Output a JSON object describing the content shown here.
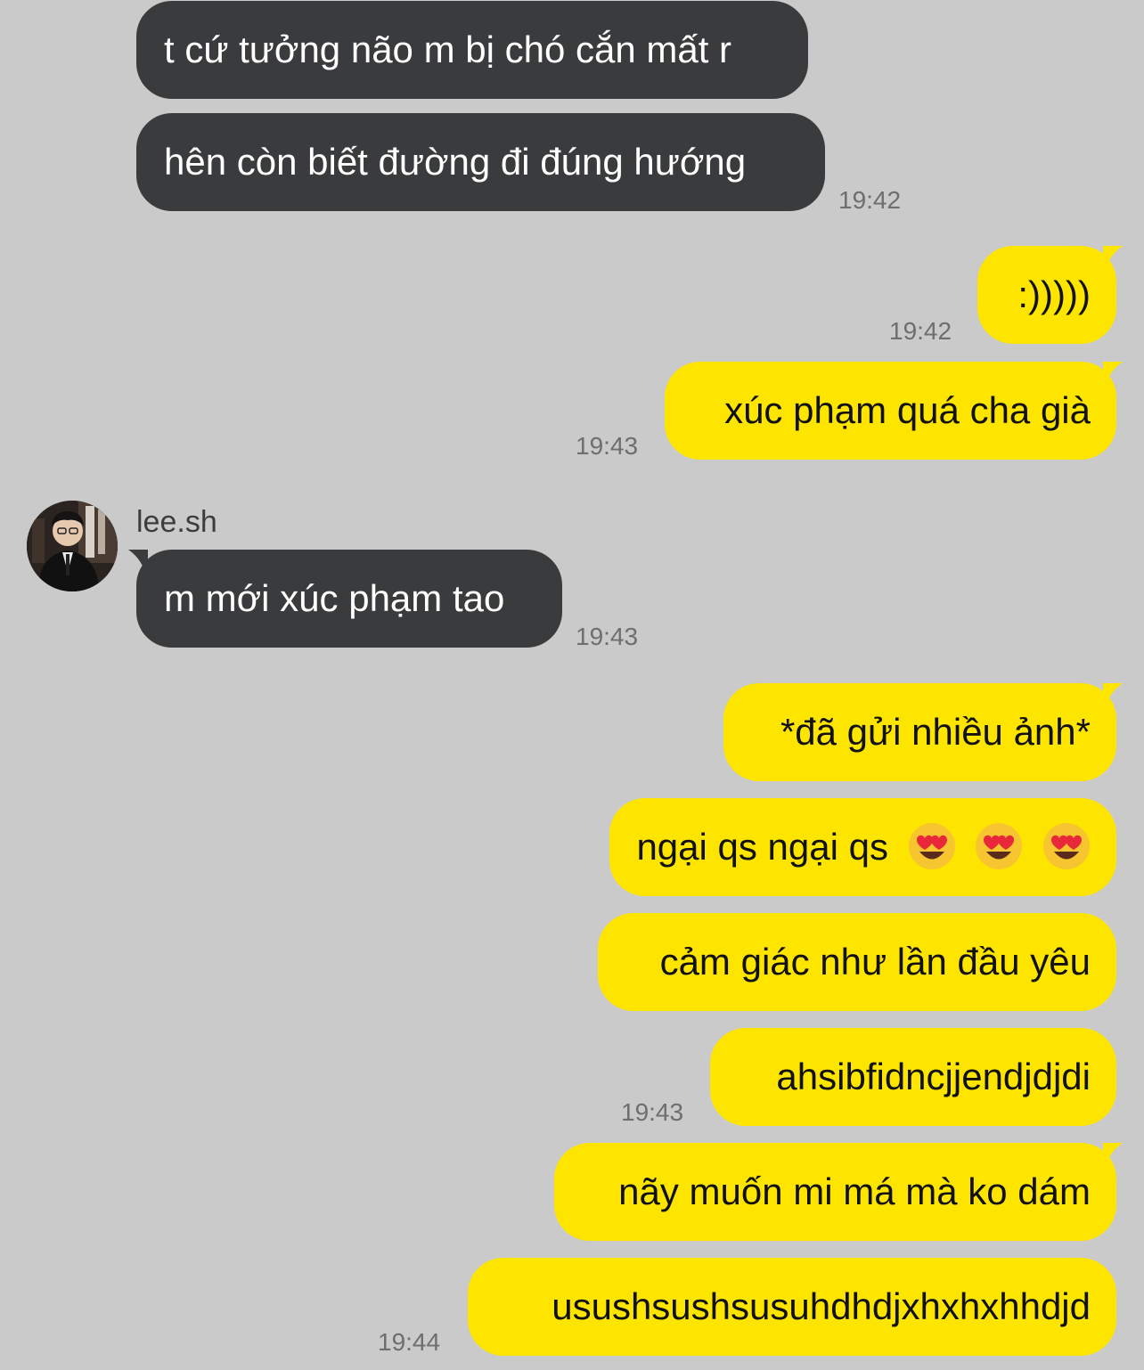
{
  "messages": [
    {
      "side": "in",
      "text": "t cứ tưởng não m bị chó cắn mất r"
    },
    {
      "side": "in",
      "text": "hên còn biết đường đi đúng hướng",
      "time": "19:42"
    },
    {
      "side": "out",
      "text": ":)))))",
      "time": "19:42"
    },
    {
      "side": "out",
      "text": "xúc phạm quá cha già",
      "time": "19:43"
    },
    {
      "side": "in",
      "sender": "lee.sh",
      "text": "m mới xúc phạm tao",
      "time": "19:43"
    },
    {
      "side": "out",
      "text": "*đã gửi nhiều ảnh*"
    },
    {
      "side": "out",
      "text": "ngại qs ngại qs",
      "emoji": "heart-eyes-emoji",
      "emoji_count": 3
    },
    {
      "side": "out",
      "text": "cảm giác như lần đầu yêu"
    },
    {
      "side": "out",
      "text": "ahsibfidncjjendjdjdi",
      "time": "19:43"
    },
    {
      "side": "out",
      "text": "nãy muốn mi má mà ko dám"
    },
    {
      "side": "out",
      "text": "usushsushsusuhdhdjxhxhxhhdjd",
      "time": "19:44"
    }
  ],
  "colors": {
    "background": "#cacaca",
    "incoming_bubble": "#3a3b3d",
    "outgoing_bubble": "#fee500",
    "timestamp": "#6e6e6e"
  },
  "icons": {
    "avatar": "user-avatar-photo"
  }
}
